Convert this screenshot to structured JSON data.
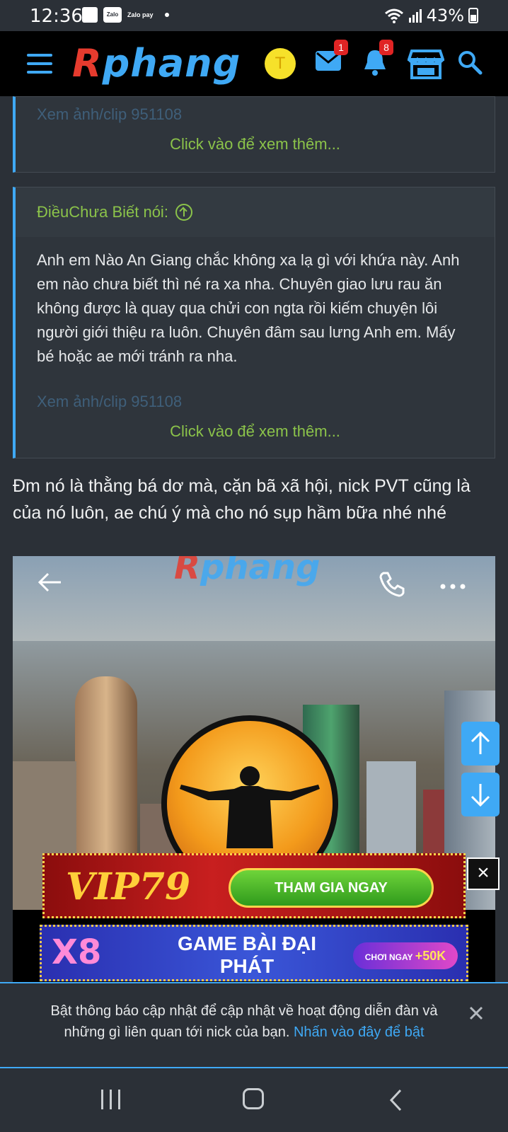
{
  "status_bar": {
    "time": "12:36",
    "battery": "43%",
    "zalo_label": "Zalo",
    "zalopay_label": "Zalo pay"
  },
  "header": {
    "logo_r": "R",
    "logo_rest": "phang",
    "avatar_letter": "T",
    "inbox_badge": "1",
    "alerts_badge": "8",
    "accent_color": "#3fa9f5"
  },
  "quote1": {
    "faded_link": "Xem ảnh/clip 951108",
    "click_more": "Click vào để xem thêm..."
  },
  "quote2": {
    "author_line": "ĐiềuChưa Biết nói:",
    "body": "Anh em Nào An Giang chắc không xa lạ gì với khứa này. Anh em nào chưa biết thì né ra xa nha. Chuyên giao lưu rau ăn không được là quay qua chửi con ngta rồi kiếm chuyện lôi người giới thiệu ra luôn. Chuyên đâm sau lưng Anh em. Mấy bé hoặc ae mới tránh ra nha.",
    "faded_link": "Xem ảnh/clip 951108",
    "click_more": "Click vào để xem thêm..."
  },
  "post": {
    "text": "Đm nó là thằng bá dơ mà, cặn bã xã hội, nick PVT cũng là của nó luôn, ae chú ý mà cho nó sụp hầm bữa nhé nhé",
    "watermark_r": "R",
    "watermark_rest": "phang"
  },
  "ads": {
    "ad1_brand": "VIP79",
    "ad1_cta": "THAM GIA NGAY",
    "ad2_brand": "X8",
    "ad2_title": "GAME BÀI ĐẠI PHÁT",
    "ad2_cta_prefix": "CHƠI NGAY",
    "ad2_cta_bonus": "+50K"
  },
  "notification": {
    "text": "Bật thông báo cập nhật để cập nhật về hoạt động diễn đàn và những gì liên quan tới nick của bạn. ",
    "link": "Nhấn vào đây để bật"
  }
}
